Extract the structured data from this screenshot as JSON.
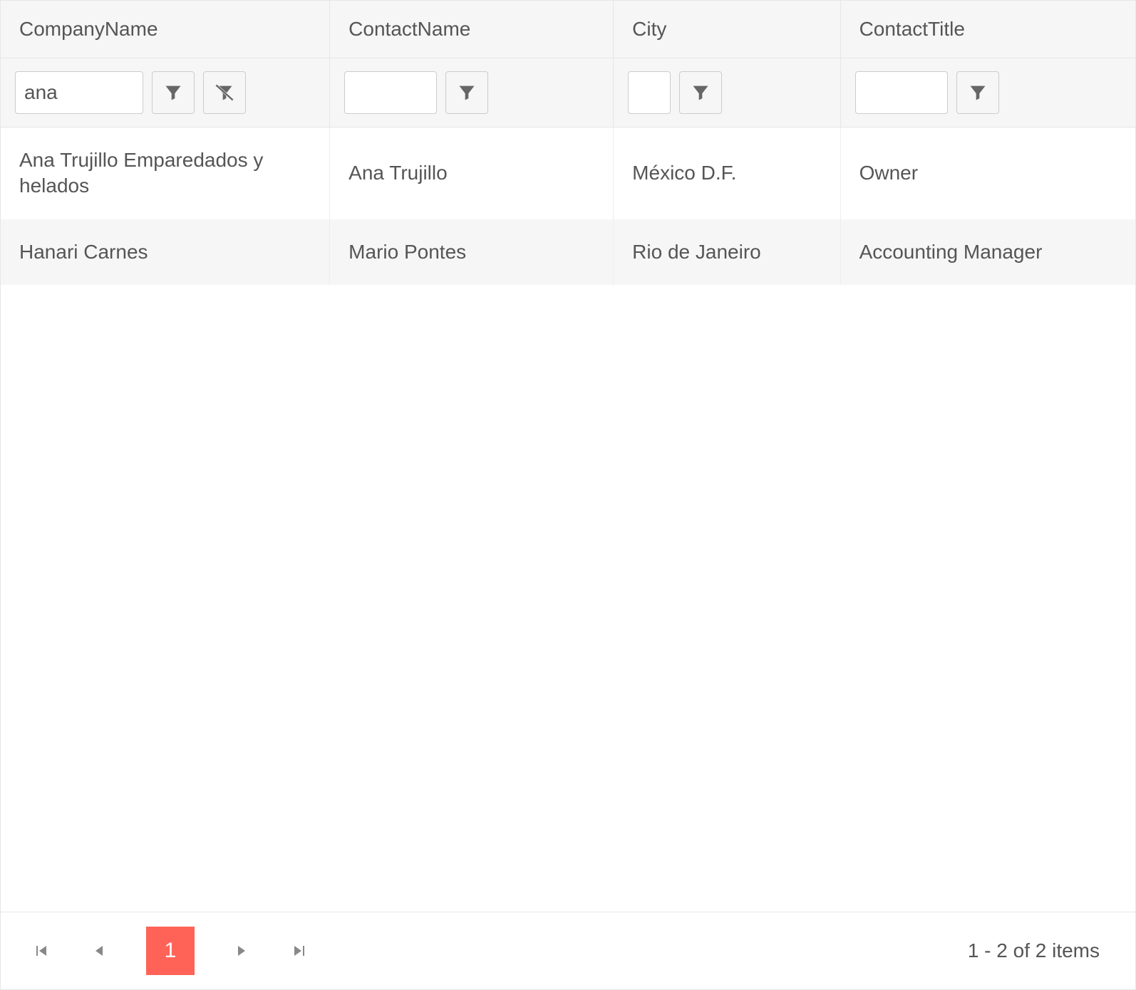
{
  "grid": {
    "columns": [
      {
        "field": "CompanyName",
        "title": "CompanyName"
      },
      {
        "field": "ContactName",
        "title": "ContactName"
      },
      {
        "field": "City",
        "title": "City"
      },
      {
        "field": "ContactTitle",
        "title": "ContactTitle"
      }
    ],
    "filters": {
      "CompanyName": "ana",
      "ContactName": "",
      "City": "",
      "ContactTitle": ""
    },
    "filterHasClear": {
      "CompanyName": true,
      "ContactName": false,
      "City": false,
      "ContactTitle": false
    },
    "rows": [
      {
        "CompanyName": "Ana Trujillo Emparedados y helados",
        "ContactName": "Ana Trujillo",
        "City": "México D.F.",
        "ContactTitle": "Owner"
      },
      {
        "CompanyName": "Hanari Carnes",
        "ContactName": "Mario Pontes",
        "City": "Rio de Janeiro",
        "ContactTitle": "Accounting Manager"
      }
    ]
  },
  "pager": {
    "currentPage": "1",
    "info": "1 - 2 of 2 items"
  },
  "icons": {
    "filter": "filter-icon",
    "clearFilter": "clear-filter-icon",
    "first": "page-first-icon",
    "prev": "page-prev-icon",
    "next": "page-next-icon",
    "last": "page-last-icon"
  }
}
